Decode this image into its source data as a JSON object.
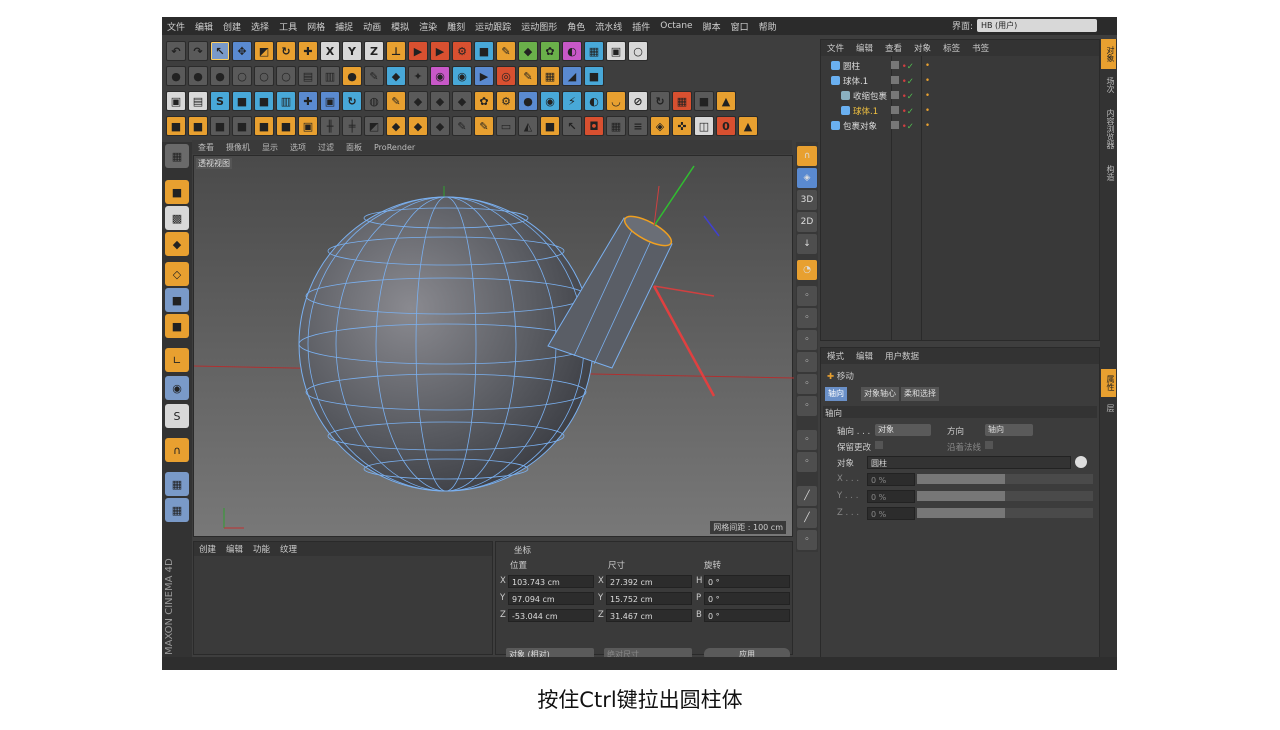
{
  "menubar": {
    "items": [
      "文件",
      "编辑",
      "创建",
      "选择",
      "工具",
      "网格",
      "捕捉",
      "动画",
      "模拟",
      "渲染",
      "雕刻",
      "运动跟踪",
      "运动图形",
      "角色",
      "流水线",
      "插件",
      "Octane",
      "脚本",
      "窗口",
      "帮助"
    ],
    "layout_label": "界面:",
    "layout_value": "HB (用户)"
  },
  "viewport": {
    "menu": [
      "查看",
      "摄像机",
      "显示",
      "选项",
      "过滤",
      "面板",
      "ProRender"
    ],
    "label": "透视视图",
    "grid_spacing": "网格间距 : 100 cm"
  },
  "object_manager": {
    "menu": [
      "文件",
      "编辑",
      "查看",
      "对象",
      "标签",
      "书签"
    ],
    "objects": [
      {
        "name": "圆柱",
        "indent": 0,
        "highlight": false
      },
      {
        "name": "球体.1",
        "indent": 0,
        "highlight": false
      },
      {
        "name": "收缩包裹",
        "indent": 1,
        "highlight": false
      },
      {
        "name": "球体.1",
        "indent": 1,
        "highlight": true
      },
      {
        "name": "包裹对象",
        "indent": 0,
        "highlight": false
      }
    ]
  },
  "side_tabs": [
    "对象",
    "场次",
    "内容浏览器",
    "构造"
  ],
  "side_tabs_lower": [
    "属性",
    "层"
  ],
  "attributes": {
    "menu": [
      "模式",
      "编辑",
      "用户数据"
    ],
    "tool_name": "移动",
    "tabs": [
      "轴向",
      "对象轴心",
      "柔和选择"
    ],
    "section": "轴向",
    "axis_label": "轴向 . . .",
    "axis_value": "对象",
    "dir_label": "方向",
    "dir_value": "轴向",
    "keep_label": "保留更改",
    "normal_label": "沿着法线",
    "object_label": "对象",
    "object_value": "圆柱",
    "xyz": [
      {
        "label": "X . . .",
        "value": "0 %"
      },
      {
        "label": "Y . . .",
        "value": "0 %"
      },
      {
        "label": "Z . . .",
        "value": "0 %"
      }
    ]
  },
  "bottom_panel": {
    "menu": [
      "创建",
      "编辑",
      "功能",
      "纹理"
    ]
  },
  "coordinates": {
    "title": "坐标",
    "col_position": "位置",
    "col_size": "尺寸",
    "col_rotation": "旋转",
    "rows": [
      {
        "axis": "X",
        "pos": "103.743 cm",
        "saxis": "X",
        "size": "27.392 cm",
        "raxis": "H",
        "rot": "0 °"
      },
      {
        "axis": "Y",
        "pos": "97.094 cm",
        "saxis": "Y",
        "size": "15.752 cm",
        "raxis": "P",
        "rot": "0 °"
      },
      {
        "axis": "Z",
        "pos": "-53.044 cm",
        "saxis": "Z",
        "size": "31.467 cm",
        "raxis": "B",
        "rot": "0 °"
      }
    ],
    "mode": "对象 (相对)",
    "size_mode": "绝对尺寸",
    "apply": "应用"
  },
  "brand": "MAXON CINEMA 4D",
  "caption": "按住Ctrl键拉出圆柱体",
  "colors": {
    "accent": "#e8a030",
    "selection": "#6a90c8",
    "wire": "#7ab0f0"
  }
}
